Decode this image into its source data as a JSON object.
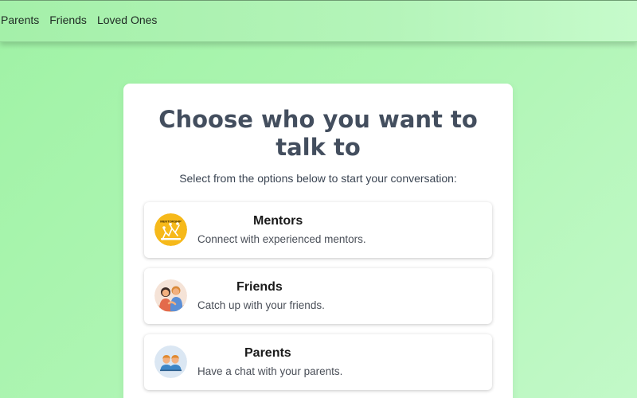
{
  "nav": {
    "links": [
      "Parents",
      "Friends",
      "Loved Ones"
    ]
  },
  "card": {
    "title": "Choose who you want to talk to",
    "subtitle": "Select from the options below to start your conversation:"
  },
  "options": [
    {
      "title": "Mentors",
      "description": "Connect with experienced mentors.",
      "icon": "mentorship-icon",
      "badge_text": "MENTORSHIP"
    },
    {
      "title": "Friends",
      "description": "Catch up with your friends.",
      "icon": "friends-icon"
    },
    {
      "title": "Parents",
      "description": "Have a chat with your parents.",
      "icon": "parents-icon"
    }
  ],
  "colors": {
    "background": "#a6f3ab",
    "title": "#434e5e",
    "card": "#ffffff",
    "mentor_badge": "#f6b91a"
  }
}
